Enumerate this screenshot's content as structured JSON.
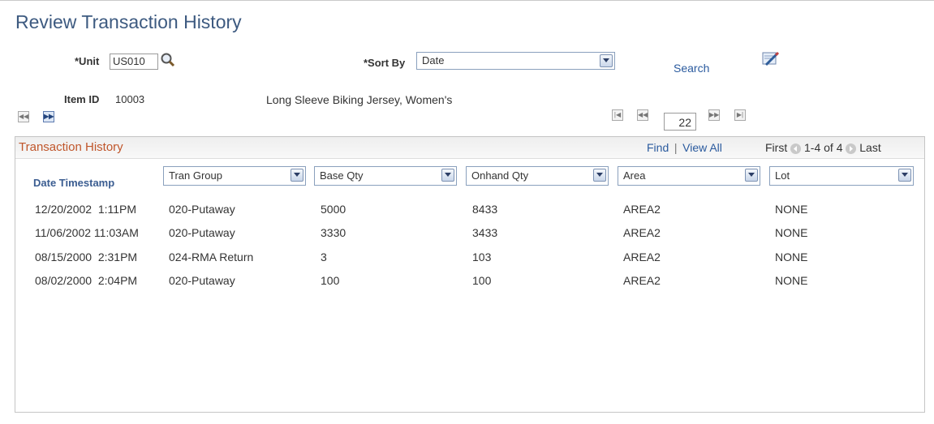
{
  "page": {
    "title": "Review Transaction History"
  },
  "criteria": {
    "unit_label": "*Unit",
    "unit_value": "US010",
    "sort_label": "*Sort By",
    "sort_value": "Date",
    "search_label": "Search"
  },
  "item": {
    "label": "Item ID",
    "id": "10003",
    "description": "Long Sleeve Biking Jersey, Women's"
  },
  "item_nav": {
    "page_value": "22"
  },
  "grid": {
    "title": "Transaction History",
    "find_label": "Find",
    "separator": "|",
    "view_all_label": "View All",
    "first_label": "First",
    "range_label": "1-4 of 4",
    "last_label": "Last",
    "date_header": "Date Timestamp",
    "column_selects": [
      "Tran Group",
      "Base Qty",
      "Onhand Qty",
      "Area",
      "Lot"
    ],
    "rows": [
      [
        "12/20/2002  1:11PM",
        "020-Putaway",
        "5000",
        "8433",
        "AREA2",
        "NONE"
      ],
      [
        "11/06/2002 11:03AM",
        "020-Putaway",
        "3330",
        "3433",
        "AREA2",
        "NONE"
      ],
      [
        "08/15/2000  2:31PM",
        "024-RMA Return",
        "3",
        "103",
        "AREA2",
        "NONE"
      ],
      [
        "08/02/2000  2:04PM",
        "020-Putaway",
        "100",
        "100",
        "AREA2",
        "NONE"
      ]
    ]
  },
  "icons": {
    "lookup": "magnifier-icon",
    "search": "search-pencil-icon",
    "nav_first": "first-icon",
    "nav_prev": "previous-icon",
    "nav_next": "next-icon",
    "nav_last": "last-icon"
  },
  "colors": {
    "title": "#3d5a80",
    "link": "#2a5a9e",
    "group_title": "#c0562b",
    "column_header": "#3b5d91"
  }
}
